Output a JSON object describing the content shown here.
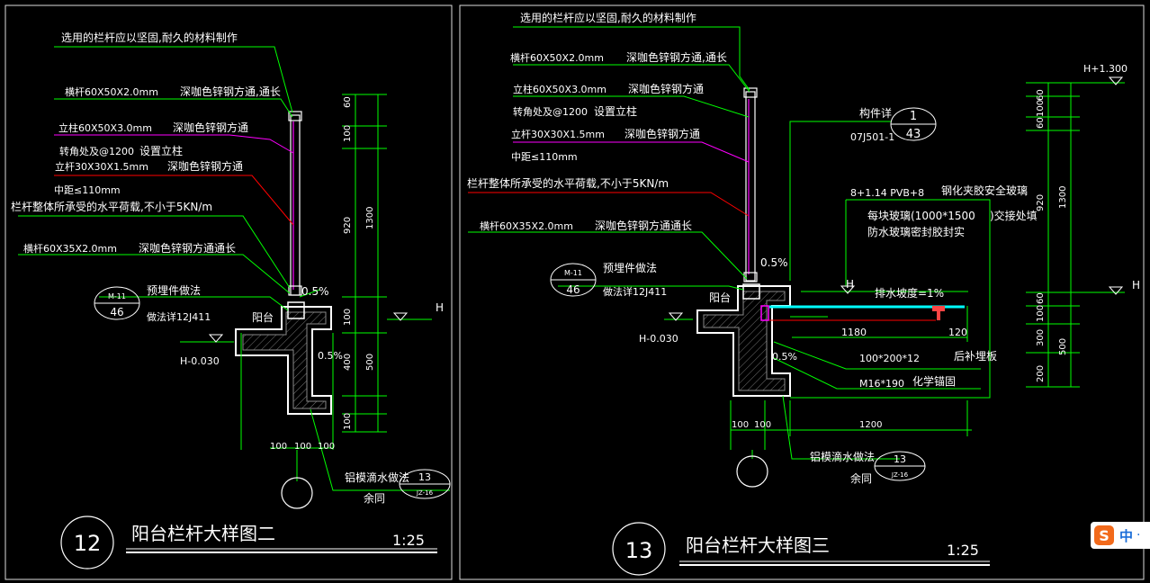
{
  "drawing12": {
    "number": "12",
    "title": "阳台栏杆大样图二",
    "scale": "1:25",
    "notes": {
      "material": "选用的栏杆应以坚固,耐久的材料制作",
      "rail_top": "横杆60X50X2.0mm",
      "rail_top_finish": "深咖色锌钢方通,通长",
      "post_main": "立柱60X50X3.0mm",
      "post_main_finish": "深咖色锌钢方通",
      "corner": "转角处及@1200",
      "corner_note": "设置立柱",
      "post_small": "立杆30X30X1.5mm",
      "post_small_finish": "深咖色锌钢方通",
      "spacing": "中距≤110mm",
      "load": "栏杆整体所承受的水平荷载,不小于5KN/m",
      "rail_bottom": "横杆60X35X2.0mm",
      "rail_bottom_finish": "深咖色锌钢方通通长",
      "embed": "预埋件做法",
      "embed_ref": "做法详12J411",
      "balcony": "阳台",
      "level": "H-0.030",
      "level_h": "H",
      "slope_top": "0.5%",
      "slope_side": "0.5%",
      "drip": "铝模滴水做法",
      "drip_same": "余同"
    },
    "detail_ref_m": {
      "top": "M-11",
      "bottom": "46"
    },
    "detail_ref_jz": {
      "top": "13",
      "bottom": "JZ-16"
    },
    "dims_vertical": [
      "60",
      "100",
      "920",
      "1300",
      "100",
      "400",
      "500",
      "100"
    ],
    "dims_horizontal": [
      "100",
      "100",
      "100"
    ]
  },
  "drawing13": {
    "number": "13",
    "title": "阳台栏杆大样图三",
    "scale": "1:25",
    "notes": {
      "material": "选用的栏杆应以坚固,耐久的材料制作",
      "rail_top": "横杆60X50X2.0mm",
      "rail_top_finish": "深咖色锌钢方通,通长",
      "post_main": "立柱60X50X3.0mm",
      "post_main_finish": "深咖色锌钢方通",
      "corner": "转角处及@1200",
      "corner_note": "设置立柱",
      "post_small": "立杆30X30X1.5mm",
      "post_small_finish": "深咖色锌钢方通",
      "spacing": "中距≤110mm",
      "load": "栏杆整体所承受的水平荷载,不小于5KN/m",
      "rail_bottom": "横杆60X35X2.0mm",
      "rail_bottom_finish": "深咖色锌钢方通通长",
      "embed": "预埋件做法",
      "embed_ref": "做法详12J411",
      "balcony": "阳台",
      "level": "H-0.030",
      "component": "构件详",
      "component_ref": "07J501-1",
      "glass_spec": "8+1.14 PVB+8",
      "glass_type": "钢化夹胶安全玻璃",
      "glass_size": "每块玻璃(1000*1500",
      "glass_joint": ")交接处填",
      "glass_seal": "防水玻璃密封胶封实",
      "drain": "排水坡度=1%",
      "dim_1180": "1180",
      "dim_120": "120",
      "plate": "100*200*12",
      "plate_note": "后补埋板",
      "anchor": "M16*190",
      "anchor_note": "化学锚固",
      "slope_top": "0.5%",
      "slope_side": "0.5%",
      "drip": "铝模滴水做法",
      "drip_same": "余同",
      "level_h1": "H",
      "level_h2": "H",
      "level_top": "H+1.300"
    },
    "detail_ref_m": {
      "top": "M-11",
      "bottom": "46"
    },
    "detail_ref_jz": {
      "top": "13",
      "bottom": "JZ-16"
    },
    "detail_ref_comp": {
      "top": "1",
      "bottom": "43"
    },
    "dims_vertical": [
      "60",
      "100",
      "60",
      "920",
      "1300",
      "60",
      "100",
      "300",
      "500",
      "200"
    ],
    "dims_horizontal": [
      "100",
      "100",
      "1200"
    ]
  },
  "ime": {
    "logo": "S",
    "mode": "中",
    "punct": "·"
  },
  "colors": {
    "background": "#000000",
    "line_green": "#00ff00",
    "text_white": "#ffffff",
    "glass_cyan": "#00ffff",
    "leader_red": "#ff0000",
    "leader_magenta": "#ff00ff",
    "anchor_red": "#ff3333"
  }
}
